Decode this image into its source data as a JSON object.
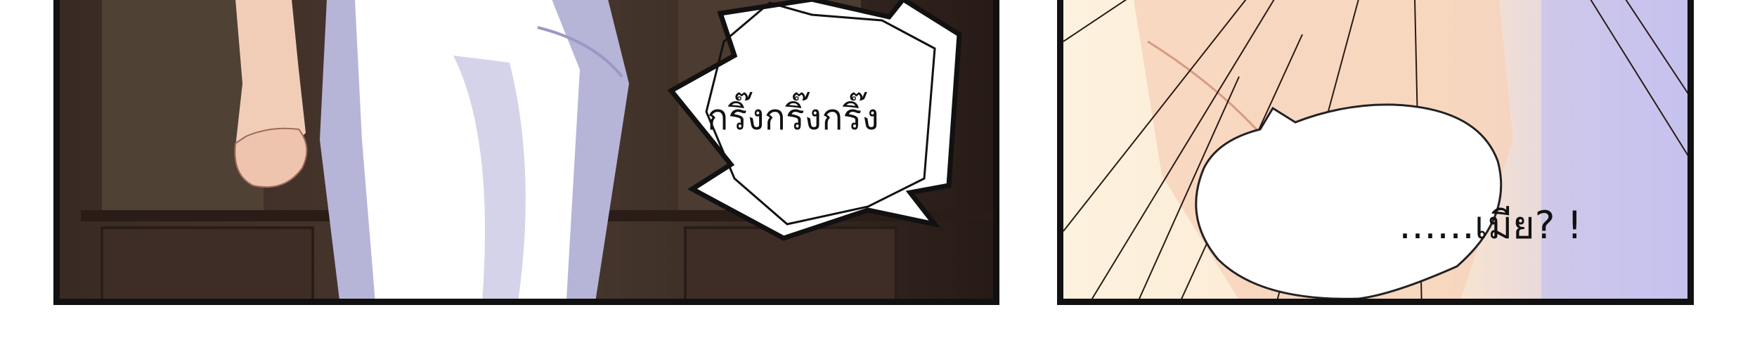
{
  "panels": {
    "left": {
      "sfx_bubble": {
        "text": "กริ๊งกริ๊งกริ๊ง"
      }
    },
    "right": {
      "speech_bubble": {
        "text": "……เมีย? !"
      }
    }
  },
  "colors": {
    "border": "#111111",
    "room_dark": "#3b2a22",
    "apron": "#ffffff",
    "apron_shadow": "#a8a7cf",
    "skin": "#f4d2c0",
    "light_bg": "#fdf1dc"
  }
}
